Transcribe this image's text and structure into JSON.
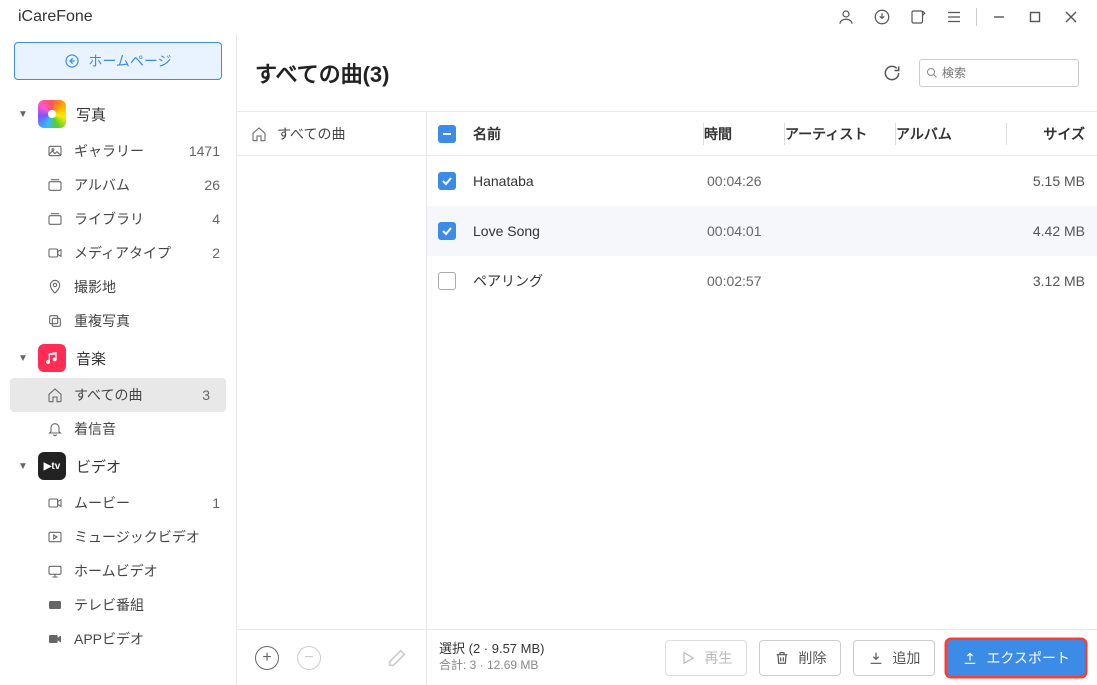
{
  "app": {
    "title": "iCareFone",
    "home_button": "ホームページ"
  },
  "sidebar": {
    "photos": {
      "label": "写真",
      "items": [
        {
          "label": "ギャラリー",
          "count": "1471"
        },
        {
          "label": "アルバム",
          "count": "26"
        },
        {
          "label": "ライブラリ",
          "count": "4"
        },
        {
          "label": "メディアタイプ",
          "count": "2"
        },
        {
          "label": "撮影地",
          "count": ""
        },
        {
          "label": "重複写真",
          "count": ""
        }
      ]
    },
    "music": {
      "label": "音楽",
      "items": [
        {
          "label": "すべての曲",
          "count": "3"
        },
        {
          "label": "着信音",
          "count": ""
        }
      ]
    },
    "video": {
      "label": "ビデオ",
      "items": [
        {
          "label": "ムービー",
          "count": "1"
        },
        {
          "label": "ミュージックビデオ",
          "count": ""
        },
        {
          "label": "ホームビデオ",
          "count": ""
        },
        {
          "label": "テレビ番組",
          "count": ""
        },
        {
          "label": "APPビデオ",
          "count": ""
        }
      ]
    }
  },
  "header": {
    "title": "すべての曲(3)",
    "search_placeholder": "検索"
  },
  "subpanel": {
    "all_songs": "すべての曲"
  },
  "table": {
    "columns": {
      "name": "名前",
      "time": "時間",
      "artist": "アーティスト",
      "album": "アルバム",
      "size": "サイズ"
    },
    "rows": [
      {
        "checked": true,
        "name": "Hanataba",
        "time": "00:04:26",
        "artist": "",
        "album": "",
        "size": "5.15 MB"
      },
      {
        "checked": true,
        "name": "Love Song",
        "time": "00:04:01",
        "artist": "",
        "album": "",
        "size": "4.42 MB"
      },
      {
        "checked": false,
        "name": "ペアリング",
        "time": "00:02:57",
        "artist": "",
        "album": "",
        "size": "3.12 MB"
      }
    ]
  },
  "footer": {
    "selection": "選択 (2 · 9.57 MB)",
    "total": "合計: 3 · 12.69 MB",
    "play": "再生",
    "delete": "削除",
    "add": "追加",
    "export": "エクスポート"
  }
}
